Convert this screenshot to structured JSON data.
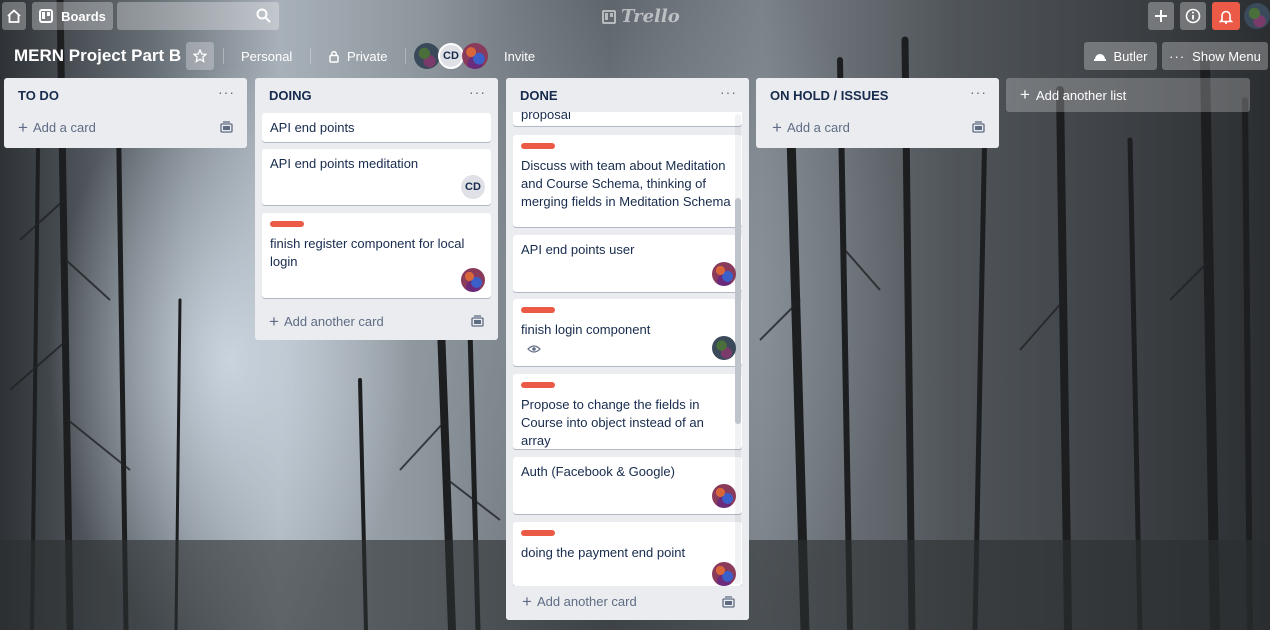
{
  "app": {
    "logo_text": "Trello"
  },
  "topbar": {
    "boards_label": "Boards",
    "search_placeholder": ""
  },
  "board": {
    "title": "MERN Project Part B",
    "team_label": "Personal",
    "visibility_label": "Private",
    "invite_label": "Invite",
    "butler_label": "Butler",
    "show_menu_label": "Show Menu",
    "member_initials": "CD"
  },
  "colors": {
    "label_red": "#eb5a46",
    "notification_red": "#eb5a46",
    "list_bg": "#ebecf0"
  },
  "lists": [
    {
      "title": "TO DO",
      "add_card": "Add a card",
      "cards": []
    },
    {
      "title": "DOING",
      "add_card": "Add another card",
      "cards": [
        {
          "text": "API end points"
        },
        {
          "text": "API end points meditation",
          "member": "CD"
        },
        {
          "text": "finish register component for local login",
          "label": "red"
        }
      ]
    },
    {
      "title": "DONE",
      "add_card": "Add another card",
      "cards": [
        {
          "text": "proposal"
        },
        {
          "text": "Discuss with team about Meditation and Course Schema, thinking of merging fields in Meditation Schema",
          "label": "red"
        },
        {
          "text": "API end points user"
        },
        {
          "text": "finish login component",
          "label": "red"
        },
        {
          "text": "Propose to change the fields in Course into object instead of an array",
          "label": "red"
        },
        {
          "text": "Auth (Facebook & Google)"
        },
        {
          "text": "doing the payment end point",
          "label": "red"
        }
      ]
    },
    {
      "title": "ON HOLD / ISSUES",
      "add_card": "Add a card",
      "cards": []
    }
  ],
  "add_list_label": "Add another list"
}
